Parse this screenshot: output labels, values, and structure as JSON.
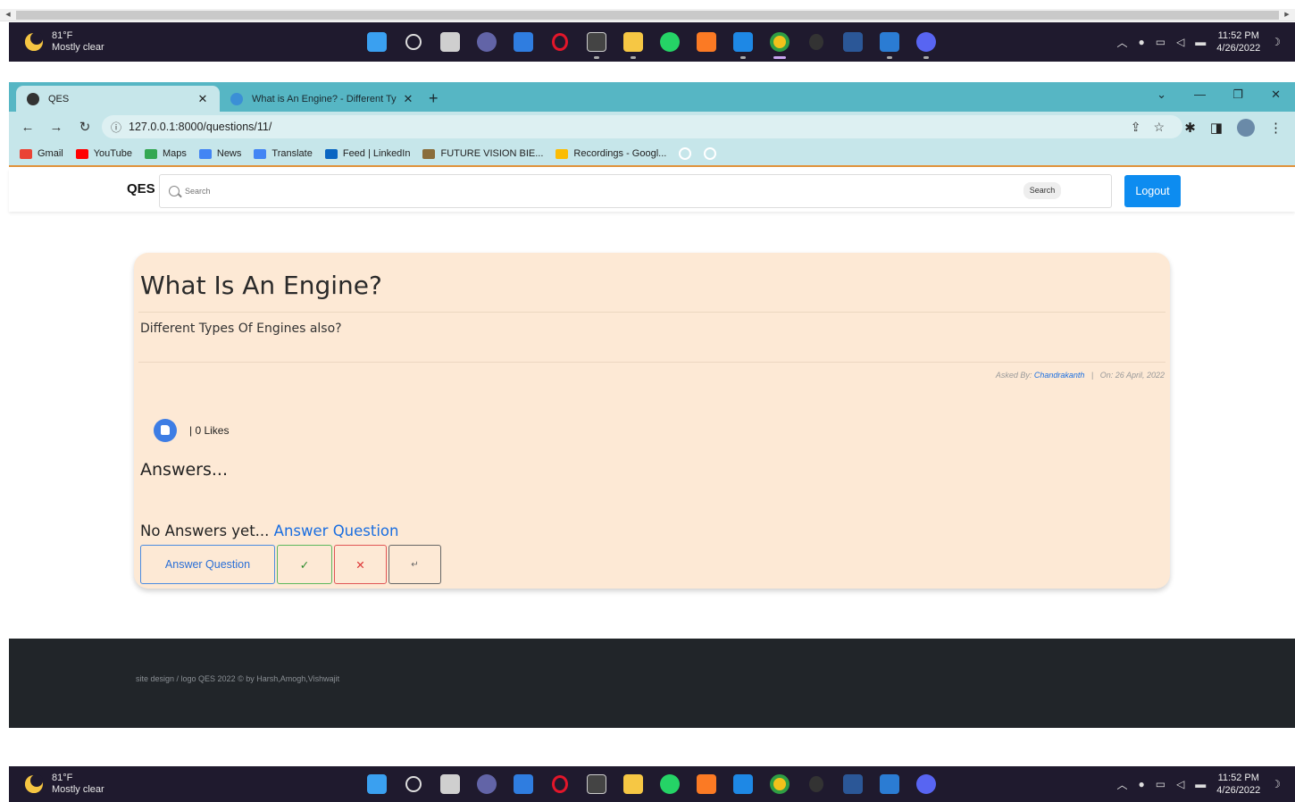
{
  "taskbar": {
    "temperature": "81°F",
    "weather": "Mostly clear",
    "time": "11:52 PM",
    "date": "4/26/2022"
  },
  "browser": {
    "tabs": [
      {
        "title": "QES",
        "active": true
      },
      {
        "title": "What is An Engine? - Different Ty",
        "active": false
      }
    ],
    "url": "127.0.0.1:8000/questions/11/",
    "bookmarks": [
      "Gmail",
      "YouTube",
      "Maps",
      "News",
      "Translate",
      "Feed | LinkedIn",
      "FUTURE VISION BIE...",
      "Recordings - Googl..."
    ]
  },
  "navbar": {
    "brand": "QES",
    "search_placeholder": "Search",
    "search_button": "Search",
    "logout": "Logout"
  },
  "question": {
    "title": "What Is An Engine?",
    "description": "Different Types Of Engines also?",
    "asked_by_label": "Asked By:",
    "author": "Chandrakanth",
    "separator": "|",
    "date_text": "On: 26 April, 2022",
    "likes": "| 0 Likes"
  },
  "answers": {
    "heading": "Answers...",
    "empty_text": "No Answers yet...",
    "answer_link": "Answer Question",
    "buttons": {
      "answer": "Answer Question",
      "check": "✓",
      "delete": "✕",
      "reply": "↵"
    }
  },
  "footer": {
    "text": "site design / logo QES 2022 © by Harsh,Amogh,Vishwajit"
  },
  "colors": {
    "tab_strip": "#56b6c4",
    "toolbar": "#c6e6ea",
    "card_bg": "#fde9d5",
    "primary": "#0d8cf0",
    "footer_bg": "#212529",
    "link": "#1a6ee0"
  }
}
